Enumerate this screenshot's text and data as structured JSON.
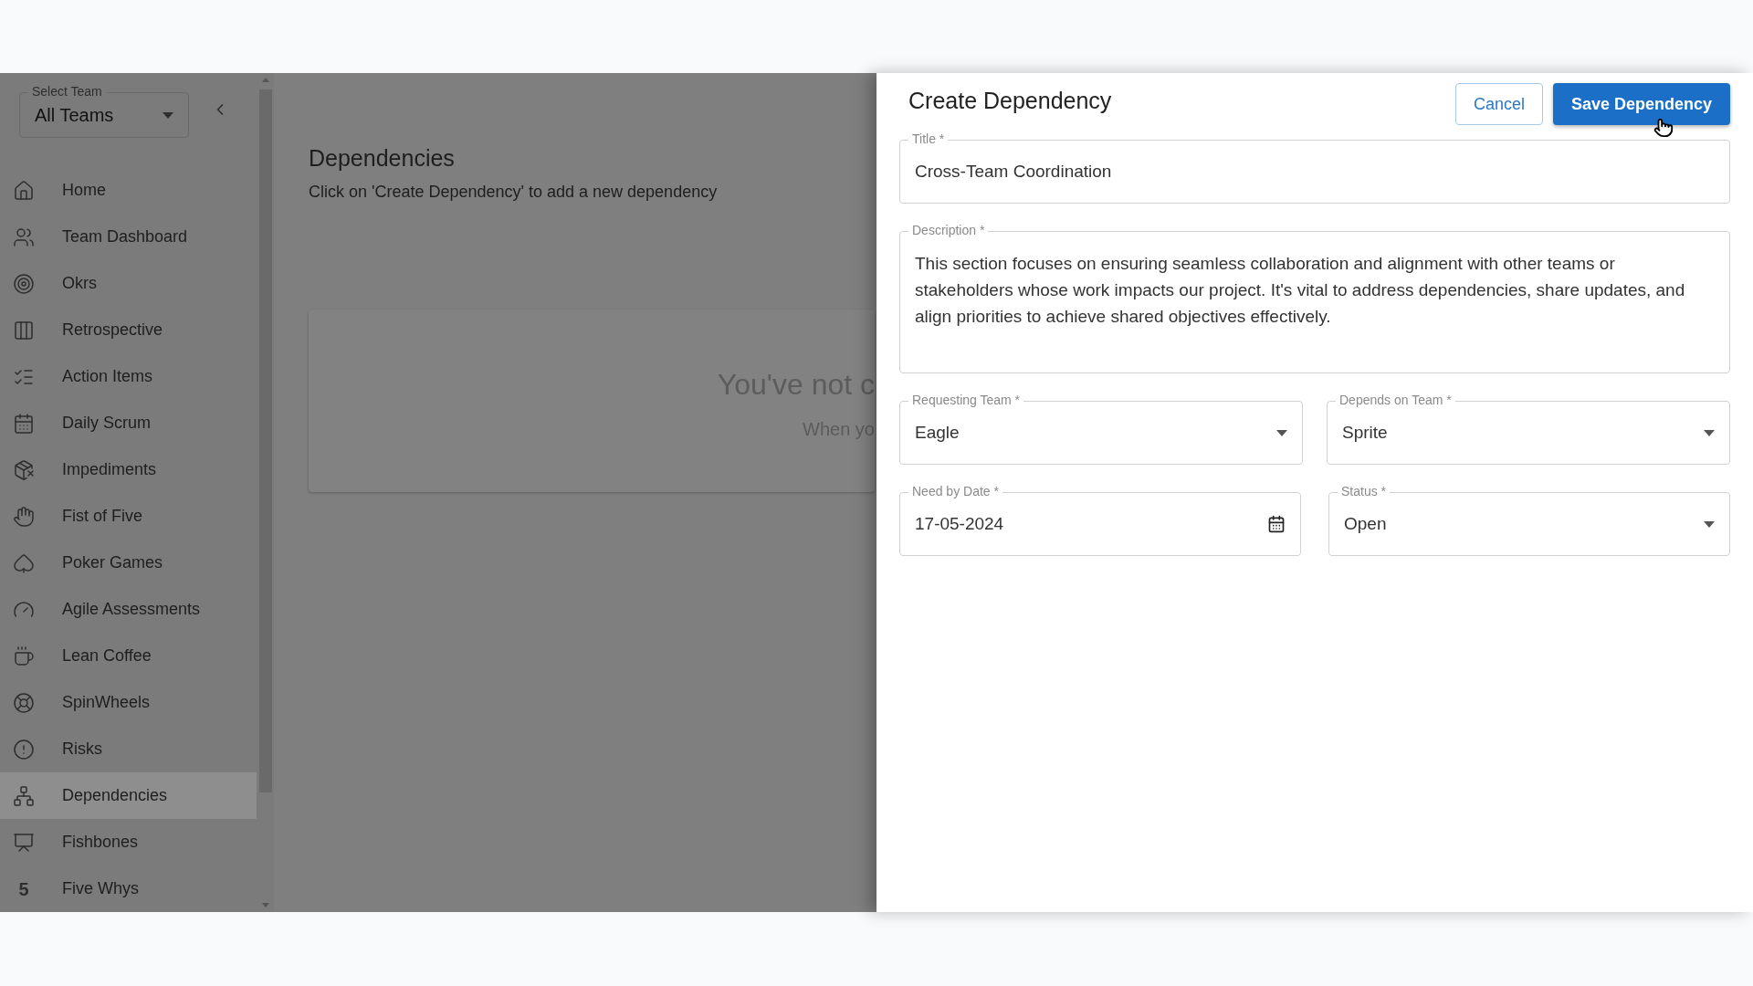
{
  "sidebar": {
    "team_select": {
      "label": "Select Team",
      "value": "All Teams"
    },
    "items": [
      {
        "label": "Home",
        "selected": false
      },
      {
        "label": "Team Dashboard",
        "selected": false
      },
      {
        "label": "Okrs",
        "selected": false
      },
      {
        "label": "Retrospective",
        "selected": false
      },
      {
        "label": "Action Items",
        "selected": false
      },
      {
        "label": "Daily Scrum",
        "selected": false
      },
      {
        "label": "Impediments",
        "selected": false
      },
      {
        "label": "Fist of Five",
        "selected": false
      },
      {
        "label": "Poker Games",
        "selected": false
      },
      {
        "label": "Agile Assessments",
        "selected": false
      },
      {
        "label": "Lean Coffee",
        "selected": false
      },
      {
        "label": "SpinWheels",
        "selected": false
      },
      {
        "label": "Risks",
        "selected": false
      },
      {
        "label": "Dependencies",
        "selected": true
      },
      {
        "label": "Fishbones",
        "selected": false
      },
      {
        "label": "Five Whys",
        "selected": false,
        "icon_text": "5"
      }
    ]
  },
  "page": {
    "title": "Dependencies",
    "subtitle": "Click on 'Create Dependency' to add a new dependency",
    "empty_state": {
      "heading": "You've not c",
      "text": "When yo"
    }
  },
  "drawer": {
    "title": "Create Dependency",
    "buttons": {
      "cancel": "Cancel",
      "save": "Save Dependency"
    },
    "fields": [
      {
        "kind": "text",
        "label": "Title *",
        "value": "Cross-Team Coordination"
      },
      {
        "kind": "textarea",
        "label": "Description *",
        "value": "This section focuses on ensuring seamless collaboration and alignment with other teams or stakeholders whose work impacts our project. It's vital to address dependencies, share updates, and align priorities to achieve shared objectives effectively."
      },
      {
        "kind": "select",
        "label": "Requesting Team *",
        "value": "Eagle"
      },
      {
        "kind": "select",
        "label": "Depends on Team *",
        "value": "Sprite"
      },
      {
        "kind": "date",
        "label": "Need by Date *",
        "value": "17-05-2024"
      },
      {
        "kind": "select",
        "label": "Status *",
        "value": "Open"
      }
    ]
  }
}
